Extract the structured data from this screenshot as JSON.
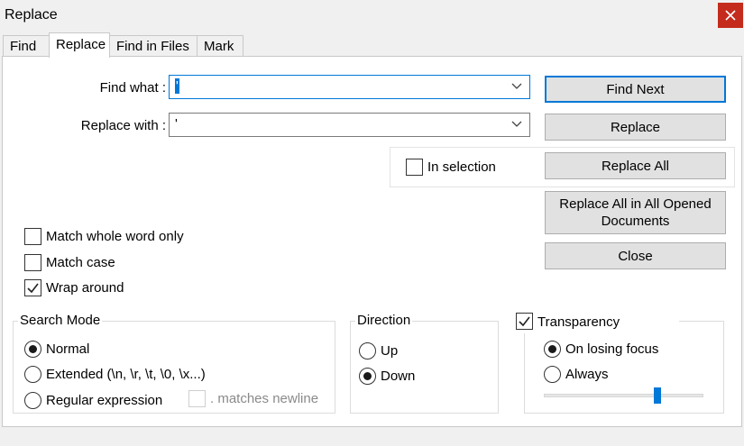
{
  "window": {
    "title": "Replace"
  },
  "tabs": [
    {
      "label": "Find",
      "active": false
    },
    {
      "label": "Replace",
      "active": true
    },
    {
      "label": "Find in Files",
      "active": false
    },
    {
      "label": "Mark",
      "active": false
    }
  ],
  "find": {
    "label": "Find what :",
    "value": "'"
  },
  "replace": {
    "label": "Replace with :",
    "value": "'"
  },
  "buttons": {
    "find_next": "Find Next",
    "replace": "Replace",
    "replace_all": "Replace All",
    "replace_all_opened": "Replace All in All Opened Documents",
    "close": "Close"
  },
  "in_selection": {
    "label": "In selection",
    "checked": false
  },
  "options": {
    "match_whole_word": {
      "label": "Match whole word only",
      "checked": false
    },
    "match_case": {
      "label": "Match case",
      "checked": false
    },
    "wrap_around": {
      "label": "Wrap around",
      "checked": true
    }
  },
  "search_mode": {
    "title": "Search Mode",
    "normal": "Normal",
    "extended": "Extended (\\n, \\r, \\t, \\0, \\x...)",
    "regex": "Regular expression",
    "matches_newline": ". matches newline",
    "selected": "normal"
  },
  "direction": {
    "title": "Direction",
    "up": "Up",
    "down": "Down",
    "selected": "down"
  },
  "transparency": {
    "label": "Transparency",
    "checked": true,
    "on_losing_focus": "On losing focus",
    "always": "Always",
    "selected": "on_losing_focus",
    "level": 0.71
  },
  "colors": {
    "accent": "#0078d7",
    "close": "#c42b1c",
    "panel": "#ffffff",
    "chrome": "#f0f0f0"
  }
}
